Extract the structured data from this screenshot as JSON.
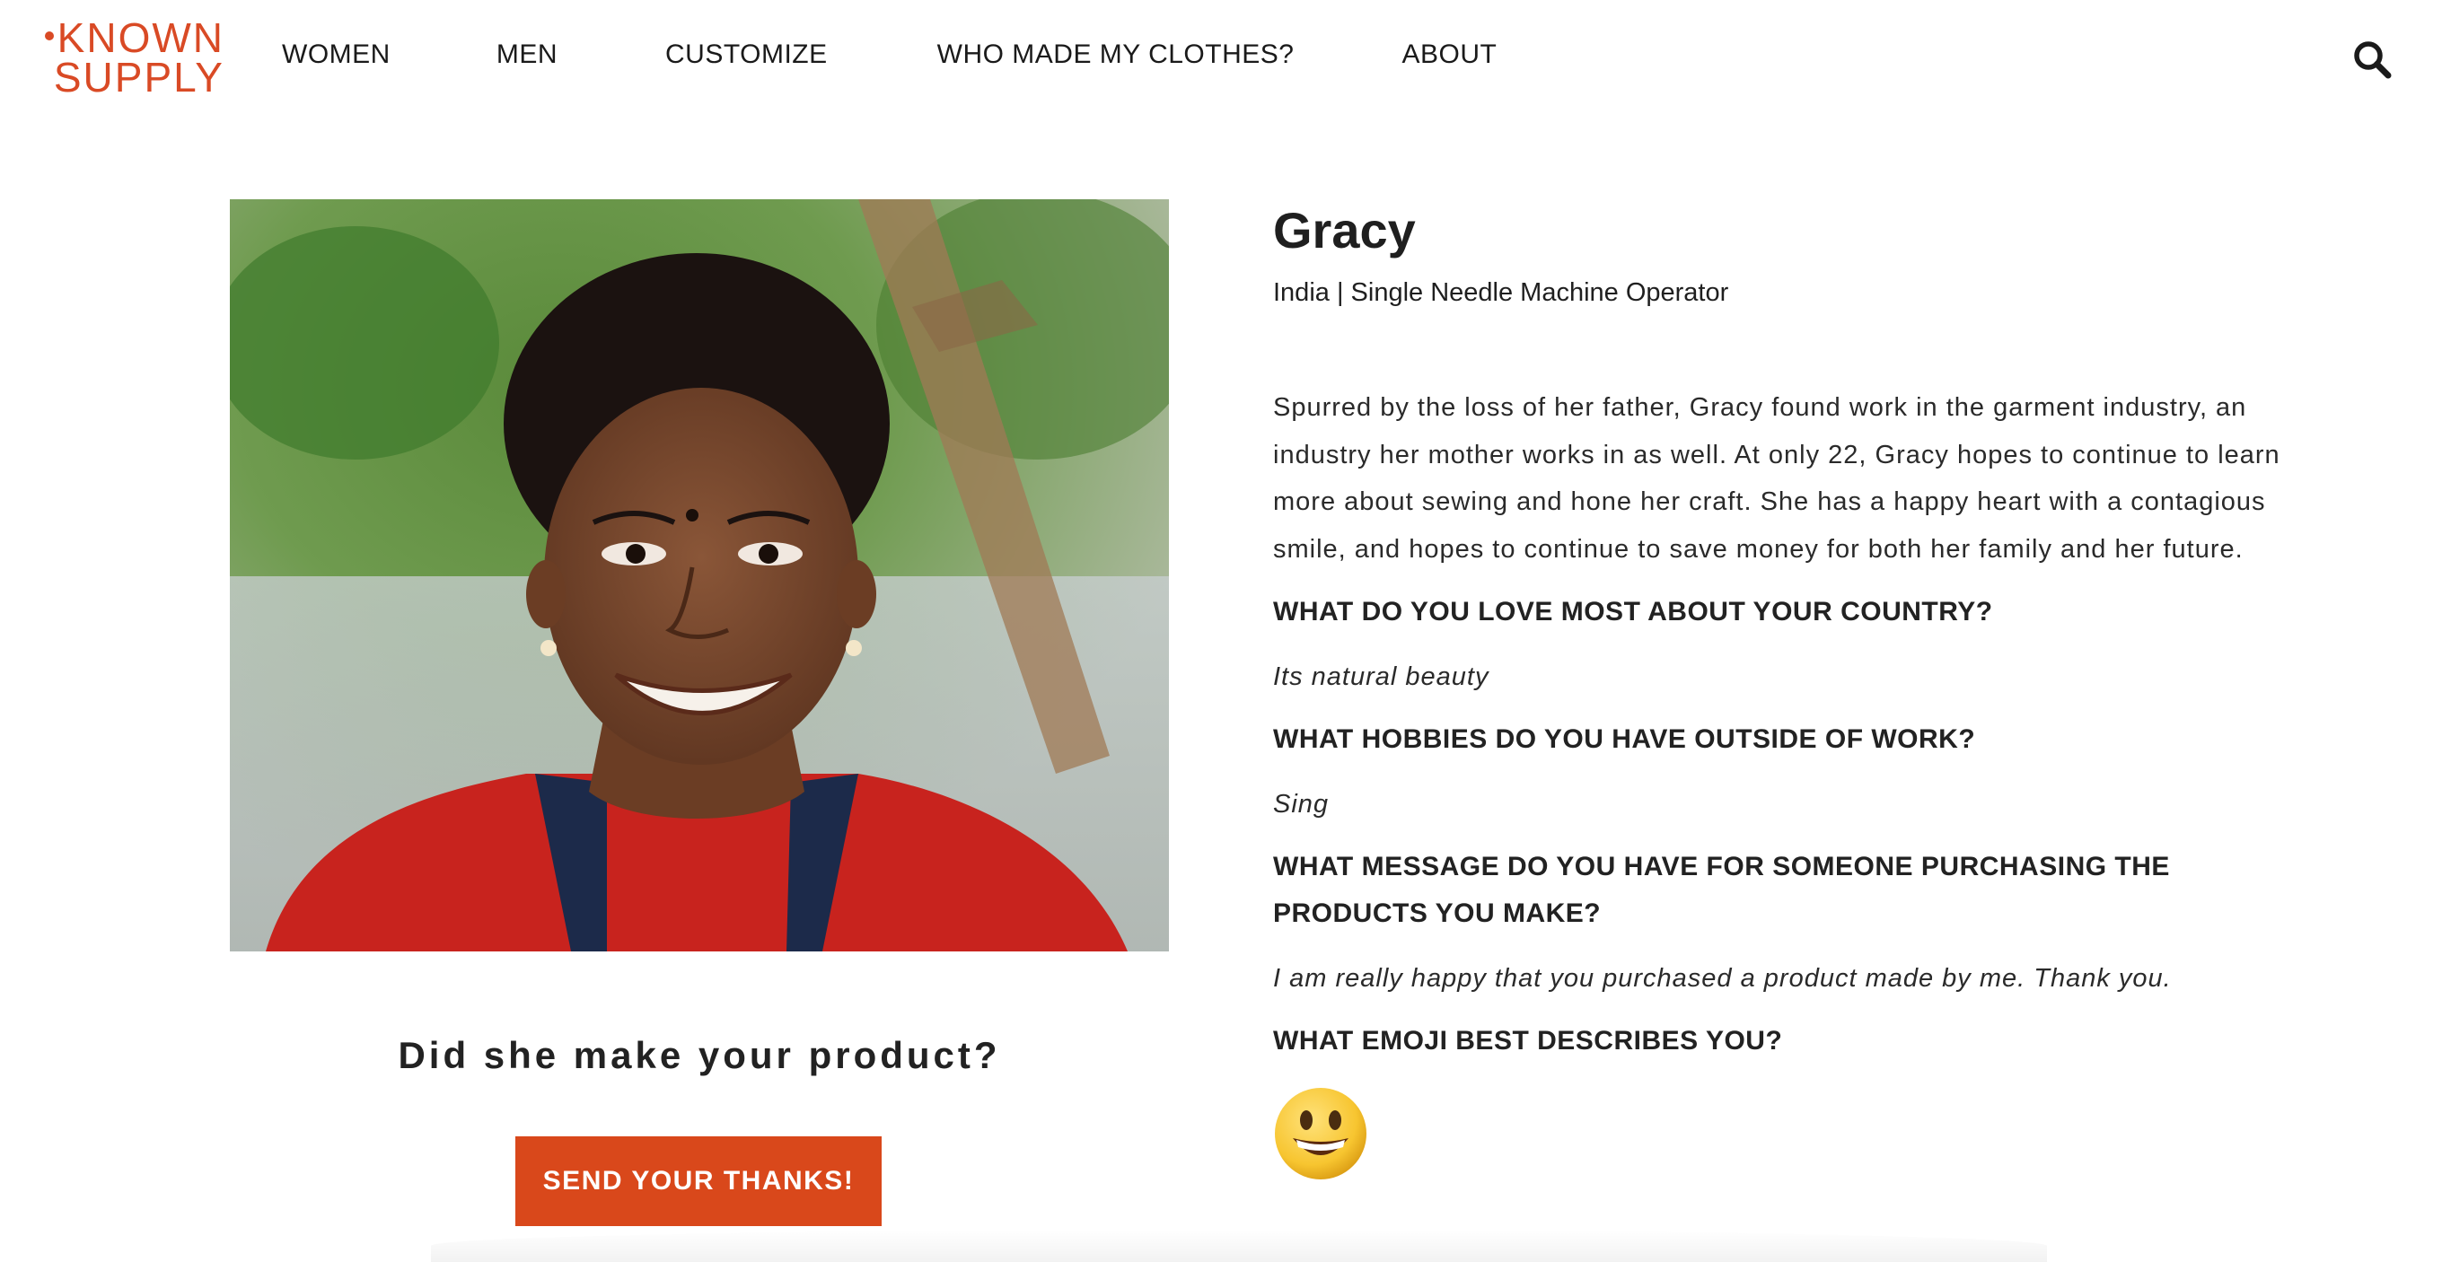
{
  "brand": {
    "logo_line1": "KNOWN",
    "logo_line2": "SUPPLY",
    "accent_color": "#d94a25"
  },
  "nav": {
    "items": [
      {
        "label": "WOMEN"
      },
      {
        "label": "MEN"
      },
      {
        "label": "CUSTOMIZE"
      },
      {
        "label": "WHO MADE MY CLOTHES?"
      },
      {
        "label": "ABOUT"
      }
    ],
    "search_icon": "search-icon"
  },
  "profile": {
    "photo": "portrait-photo",
    "name": "Gracy",
    "subtitle": "India | Single Needle Machine Operator",
    "bio": "Spurred by the loss of her father, Gracy found work in the garment industry, an industry her mother works in as well. At only 22, Gracy hopes to continue to learn more about sewing and hone her craft. She has a happy heart with a contagious smile, and hopes to continue to save money for both her family and her future.",
    "qa": [
      {
        "question": "WHAT DO YOU LOVE MOST ABOUT YOUR COUNTRY?",
        "answer": "Its natural beauty"
      },
      {
        "question": "WHAT HOBBIES DO YOU HAVE OUTSIDE OF WORK?",
        "answer": "Sing"
      },
      {
        "question": "WHAT MESSAGE DO YOU HAVE FOR SOMEONE PURCHASING THE PRODUCTS YOU MAKE?",
        "answer": "I am really happy that you purchased a product made by me. Thank you."
      },
      {
        "question": "WHAT EMOJI BEST DESCRIBES YOU?",
        "answer_icon": "grinning-face-emoji"
      }
    ]
  },
  "cta": {
    "question": "Did she make your product?",
    "button_label": "SEND YOUR THANKS!",
    "button_color": "#d9481b"
  }
}
